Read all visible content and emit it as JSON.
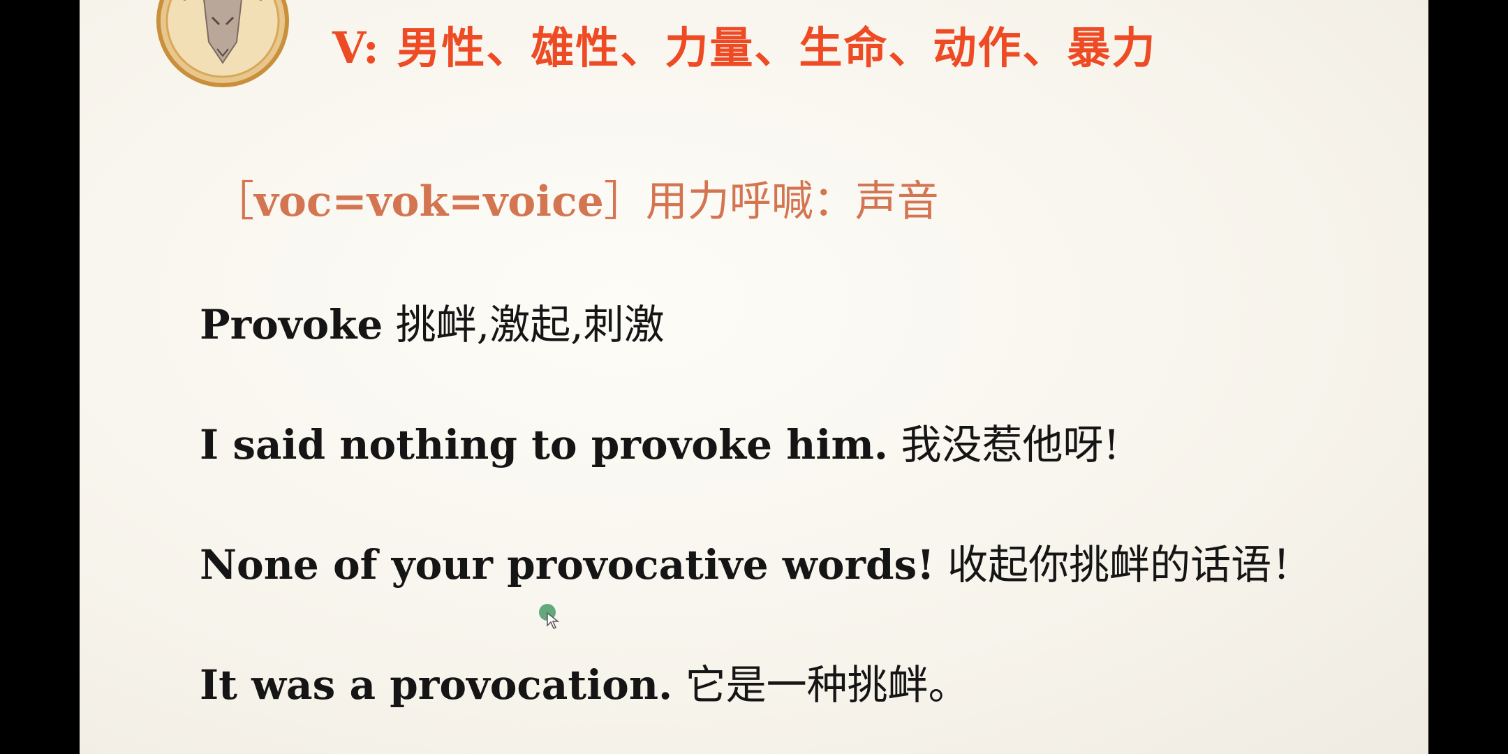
{
  "header": {
    "title": "V: 男性、雄性、力量、生命、动作、暴力"
  },
  "root": {
    "bracket_open": "［",
    "roots": "voc=vok=voice",
    "bracket_close": "］",
    "meaning": "用力呼喊：声音"
  },
  "sentences": [
    {
      "en": "Provoke",
      "zh": "挑衅,激起,刺激"
    },
    {
      "en": "I said nothing to provoke him.",
      "zh": "我没惹他呀!"
    },
    {
      "en": "None of your provocative words!",
      "zh": "收起你挑衅的话语！"
    },
    {
      "en": "It was a provocation.",
      "zh": "它是一种挑衅。"
    }
  ],
  "colors": {
    "header": "#ee4a24",
    "root": "#d47552",
    "text": "#151515",
    "logo_gold": "#e2b25a",
    "cursor": "#4a9a68"
  },
  "icons": {
    "logo": "ram-head-icon",
    "cursor": "mouse-pointer-icon"
  }
}
